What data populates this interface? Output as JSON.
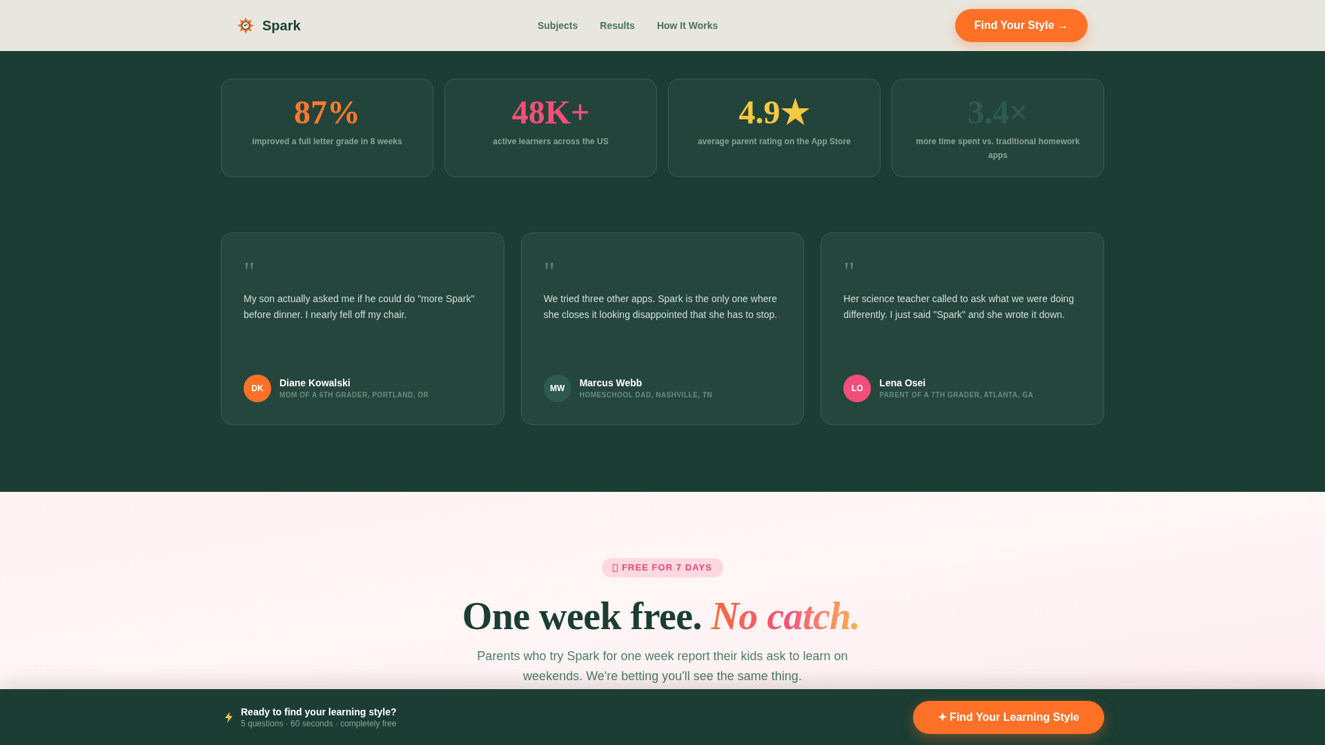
{
  "header": {
    "brand": "Spark",
    "nav": [
      "Subjects",
      "Results",
      "How It Works"
    ],
    "cta": "Find Your Style →"
  },
  "stats": [
    {
      "value": "87%",
      "label": "improved a full letter grade in 8 weeks",
      "color": "#ff7a2e"
    },
    {
      "value": "48K+",
      "label": "active learners across the US",
      "color": "#f2507a"
    },
    {
      "value": "4.9★",
      "label": "average parent rating on the App Store",
      "color": "#f7c843"
    },
    {
      "value": "3.4×",
      "label": "more time spent vs. traditional homework apps",
      "color": "#2f5b4c"
    }
  ],
  "testimonials": [
    {
      "quote_mark": "\"",
      "text": "My son actually asked me if he could do \"more Spark\" before dinner. I nearly fell off my chair.",
      "initials": "DK",
      "name": "Diane Kowalski",
      "role": "MOM OF A 6TH GRADER, PORTLAND, OR",
      "color": "#ff7126"
    },
    {
      "quote_mark": "\"",
      "text": "We tried three other apps. Spark is the only one where she closes it looking disappointed that she has to stop.",
      "initials": "MW",
      "name": "Marcus Webb",
      "role": "HOMESCHOOL DAD, NASHVILLE, TN",
      "color": "#2d5a4c"
    },
    {
      "quote_mark": "\"",
      "text": "Her science teacher called to ask what we were doing differently. I just said \"Spark\" and she wrote it down.",
      "initials": "LO",
      "name": "Lena Osei",
      "role": "PARENT OF A 7TH GRADER, ATLANTA, GA",
      "color": "#f24e7c"
    }
  ],
  "offer": {
    "badge": "FREE FOR 7 DAYS",
    "headline": "One week free.",
    "headline_accent": "No catch.",
    "body": "Parents who try Spark for one week report their kids ask to learn on weekends. We're betting you'll see the same thing."
  },
  "sticky_bar": {
    "title": "Ready to find your learning style?",
    "subtitle": "5 questions · 60 seconds · completely free",
    "cta": "✦ Find Your Learning Style"
  }
}
